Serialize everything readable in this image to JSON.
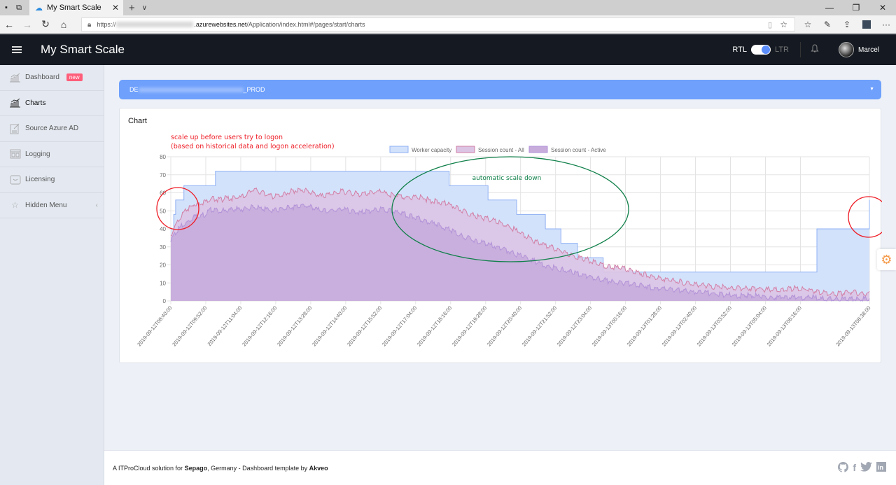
{
  "browser": {
    "tab_title": "My Smart Scale",
    "url_prefix": "https://",
    "url_domain": ".azurewebsites.net",
    "url_path": "/Application/index.html#/pages/start/charts",
    "window_controls": [
      "—",
      "❐",
      "✕"
    ]
  },
  "header": {
    "app_title": "My Smart Scale",
    "rtl_label": "RTL",
    "ltr_label": "LTR",
    "direction_toggle_on": true,
    "user_name": "Marcel"
  },
  "sidebar": {
    "items": [
      {
        "label": "Dashboard",
        "icon": "bar-chart-icon",
        "badge": "new",
        "active": false
      },
      {
        "label": "Charts",
        "icon": "bar-chart-icon",
        "active": true
      },
      {
        "label": "Source Azure AD",
        "icon": "edit-note-icon",
        "active": false
      },
      {
        "label": "Logging",
        "icon": "layout-icon",
        "active": false
      },
      {
        "label": "Licensing",
        "icon": "inbox-icon",
        "active": false
      },
      {
        "label": "Hidden Menu",
        "icon": "star-icon",
        "active": false,
        "expandable": true
      }
    ]
  },
  "selector": {
    "prefix": "DE",
    "suffix": "_PROD"
  },
  "card": {
    "title": "Chart"
  },
  "annotations": {
    "scale_up_line1": "scale up before users try to logon",
    "scale_up_line2": "(based on historical data and logon acceleration)",
    "scale_down": "automatic scale down"
  },
  "colors": {
    "worker_fill": "#d3e2fb",
    "worker_line": "#8fb0f4",
    "session_all_fill": "#dcc4e4",
    "session_all_line": "#d27fa6",
    "session_active_fill": "#c7acdc",
    "session_active_line": "#b292d8",
    "annotation_red": "#ee1c25",
    "annotation_green": "#10804a",
    "selector_bg": "#6ea0fc"
  },
  "chart_data": {
    "type": "area",
    "title": "",
    "xlabel": "",
    "ylabel": "",
    "ylim": [
      0,
      80
    ],
    "yticks": [
      0,
      10,
      20,
      30,
      40,
      50,
      60,
      70,
      80
    ],
    "grid": true,
    "legend_position": "top-center",
    "x_start": "2019-09-12T08:40:00",
    "x_end": "2019-09-13T08:38:00",
    "x_tick_labels": [
      "2019-09-12T08:40:00",
      "2019-09-12T09:52:00",
      "2019-09-12T11:04:00",
      "2019-09-12T12:16:00",
      "2019-09-12T13:28:00",
      "2019-09-12T14:40:00",
      "2019-09-12T15:52:00",
      "2019-09-12T17:04:00",
      "2019-09-12T18:16:00",
      "2019-09-12T19:28:00",
      "2019-09-12T20:40:00",
      "2019-09-12T21:52:00",
      "2019-09-12T23:04:00",
      "2019-09-13T00:16:00",
      "2019-09-13T01:28:00",
      "2019-09-13T02:40:00",
      "2019-09-13T03:52:00",
      "2019-09-13T05:04:00",
      "2019-09-13T06:16:00",
      "2019-09-13T08:38:00"
    ],
    "series": [
      {
        "name": "Worker capacity",
        "kind": "step",
        "minutes_from_start": [
          0,
          6,
          10,
          27,
          92,
          573,
          653,
          712,
          771,
          803,
          837,
          890,
          897,
          1330,
          1467,
          1490,
          1496,
          1500
        ],
        "values": [
          40,
          48,
          56,
          64,
          72,
          64,
          56,
          48,
          40,
          32,
          24,
          16,
          16,
          40,
          48,
          56,
          56,
          56
        ]
      },
      {
        "name": "Session count - All",
        "kind": "line",
        "minutes_from_start": [
          0,
          10,
          20,
          35,
          50,
          70,
          85,
          100,
          115,
          130,
          150,
          170,
          190,
          210,
          230,
          250,
          270,
          290,
          310,
          330,
          350,
          370,
          390,
          410,
          430,
          450,
          470,
          490,
          510,
          530,
          550,
          570,
          600,
          630,
          660,
          690,
          720,
          750,
          780,
          810,
          840,
          870,
          900,
          930,
          960,
          1000,
          1040,
          1080,
          1120,
          1160,
          1200,
          1240,
          1280,
          1320,
          1350,
          1380,
          1400,
          1420,
          1435,
          1450,
          1460,
          1470,
          1480,
          1490,
          1500
        ],
        "values": [
          36,
          42,
          47,
          51,
          54,
          55,
          57,
          56,
          57,
          57,
          58,
          62,
          60,
          58,
          59,
          61,
          62,
          60,
          58,
          59,
          61,
          60,
          59,
          60,
          61,
          59,
          58,
          57,
          58,
          56,
          55,
          54,
          50,
          47,
          45,
          42,
          38,
          33,
          30,
          27,
          24,
          22,
          19,
          18,
          16,
          13,
          11,
          9,
          8,
          7,
          7,
          6,
          7,
          6,
          4,
          4,
          5,
          4,
          4,
          6,
          8,
          10,
          14,
          22,
          30
        ]
      },
      {
        "name": "Session count - Active",
        "kind": "line",
        "minutes_from_start": [
          0,
          10,
          20,
          35,
          50,
          70,
          85,
          100,
          115,
          130,
          150,
          170,
          190,
          210,
          230,
          250,
          270,
          290,
          310,
          330,
          350,
          370,
          390,
          410,
          430,
          450,
          470,
          490,
          510,
          530,
          550,
          570,
          600,
          630,
          660,
          690,
          720,
          750,
          780,
          810,
          840,
          870,
          900,
          930,
          960,
          1000,
          1040,
          1080,
          1120,
          1160,
          1200,
          1240,
          1280,
          1320,
          1350,
          1380,
          1400,
          1420,
          1435,
          1450,
          1460,
          1470,
          1480,
          1490,
          1500
        ],
        "values": [
          33,
          38,
          41,
          44,
          47,
          48,
          51,
          50,
          50,
          51,
          51,
          52,
          51,
          50,
          51,
          52,
          53,
          52,
          50,
          50,
          51,
          50,
          49,
          50,
          51,
          50,
          49,
          47,
          46,
          44,
          42,
          40,
          36,
          33,
          31,
          28,
          25,
          22,
          19,
          17,
          15,
          13,
          11,
          10,
          9,
          7,
          6,
          5,
          4,
          3,
          3,
          2,
          2,
          2,
          1,
          1,
          1,
          1,
          1,
          3,
          6,
          12,
          20,
          30,
          40
        ]
      }
    ]
  },
  "footer": {
    "text_1": "A ITProCloud solution for ",
    "brand_1": "Sepago",
    "text_2": ", Germany - Dashboard template by ",
    "brand_2": "Akveo",
    "social": [
      "github-icon",
      "facebook-icon",
      "twitter-icon",
      "linkedin-icon"
    ]
  }
}
